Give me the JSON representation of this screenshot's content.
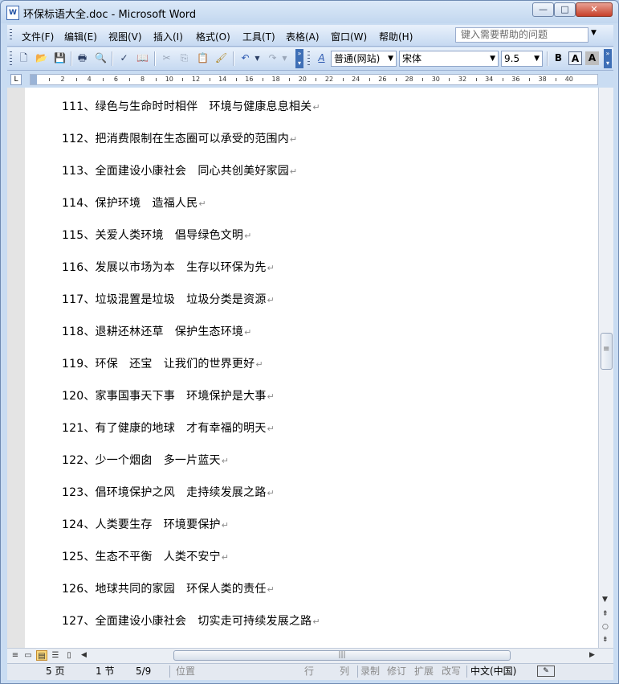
{
  "window": {
    "title": "环保标语大全.doc - Microsoft Word",
    "app_icon": "word-doc-icon",
    "controls": {
      "minimize": "—",
      "maximize": "□",
      "close": "✕"
    }
  },
  "menubar": {
    "items": [
      "文件(F)",
      "编辑(E)",
      "视图(V)",
      "插入(I)",
      "格式(O)",
      "工具(T)",
      "表格(A)",
      "窗口(W)",
      "帮助(H)"
    ],
    "help_placeholder": "键入需要帮助的问题"
  },
  "toolbar": {
    "style_value": "普通(网站)",
    "font_value": "宋体",
    "size_value": "9.5",
    "bold_label": "B",
    "outline_label": "A",
    "shade_label": "A",
    "style_icon_label": "A"
  },
  "ruler": {
    "labels": [
      "2",
      "4",
      "6",
      "8",
      "10",
      "12",
      "14",
      "16",
      "18",
      "20",
      "22",
      "24",
      "26",
      "28",
      "30",
      "32",
      "34",
      "36",
      "38",
      "40"
    ]
  },
  "document": {
    "lines": [
      "111、绿色与生命时时相伴　环境与健康息息相关",
      "112、把消费限制在生态圈可以承受的范围内",
      "113、全面建设小康社会　同心共创美好家园",
      "114、保护环境　造福人民",
      "115、关爱人类环境　倡导绿色文明",
      "116、发展以市场为本　生存以环保为先",
      "117、垃圾混置是垃圾　垃圾分类是资源",
      "118、退耕还林还草　保护生态环境",
      "119、环保　还宝　让我们的世界更好",
      "120、家事国事天下事　环境保护是大事",
      "121、有了健康的地球　才有幸福的明天",
      "122、少一个烟囱　多一片蓝天",
      "123、倡环境保护之风　走持续发展之路",
      "124、人类要生存　环境要保护",
      "125、生态不平衡　人类不安宁",
      "126、地球共同的家园　环保人类的责任",
      "127、全面建设小康社会　切实走可持续发展之路"
    ],
    "paragraph_mark": "↵"
  },
  "statusbar": {
    "page": "5 页",
    "section": "1 节",
    "page_of": "5/9",
    "position": "位置",
    "line": "行",
    "column": "列",
    "rec": "录制",
    "trk": "修订",
    "ext": "扩展",
    "ovr": "改写",
    "language": "中文(中国)"
  }
}
